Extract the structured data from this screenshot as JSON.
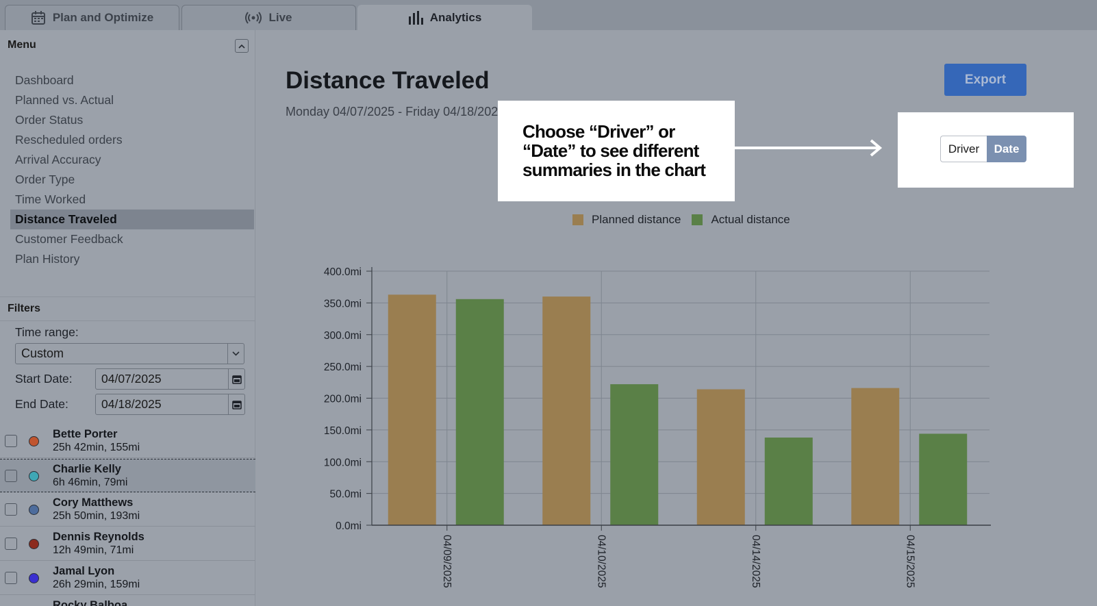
{
  "tabs": [
    {
      "label": "Plan and Optimize",
      "icon": "calendar-icon"
    },
    {
      "label": "Live",
      "icon": "broadcast-icon"
    },
    {
      "label": "Analytics",
      "icon": "bar-chart-icon"
    }
  ],
  "menu": {
    "title": "Menu",
    "items": [
      "Dashboard",
      "Planned vs. Actual",
      "Order Status",
      "Rescheduled orders",
      "Arrival Accuracy",
      "Order Type",
      "Time Worked",
      "Distance Traveled",
      "Customer Feedback",
      "Plan History"
    ],
    "active_index": 7
  },
  "filters": {
    "title": "Filters",
    "time_range_label": "Time range:",
    "time_range_value": "Custom",
    "start_label": "Start Date:",
    "start_value": "04/07/2025",
    "end_label": "End Date:",
    "end_value": "04/18/2025"
  },
  "drivers": [
    {
      "name": "Bette Porter",
      "stats": "25h 42min, 155mi",
      "color": "#c0552f"
    },
    {
      "name": "Charlie Kelly",
      "stats": "6h 46min, 79mi",
      "color": "#3fa7b5"
    },
    {
      "name": "Cory Matthews",
      "stats": "25h 50min, 193mi",
      "color": "#4d6c9c"
    },
    {
      "name": "Dennis Reynolds",
      "stats": "12h 49min, 71mi",
      "color": "#8c2b1e"
    },
    {
      "name": "Jamal Lyon",
      "stats": "26h 29min, 159mi",
      "color": "#3a2fd0"
    },
    {
      "name": "Rocky Balboa",
      "stats": "",
      "color": "#4aa03a"
    }
  ],
  "main": {
    "title": "Distance Traveled",
    "subtitle": "Monday 04/07/2025 - Friday 04/18/202",
    "export_label": "Export",
    "callout_lines": [
      "Choose “Driver” or",
      "“Date” to see different",
      "summaries in the chart"
    ],
    "toggle": {
      "driver": "Driver",
      "date": "Date",
      "selected": "Date"
    }
  },
  "chart_data": {
    "type": "bar",
    "categories": [
      "04/09/2025",
      "04/10/2025",
      "04/14/2025",
      "04/15/2025"
    ],
    "series": [
      {
        "name": "Planned distance",
        "color": "#9a7e50",
        "values": [
          363,
          360,
          214,
          216
        ]
      },
      {
        "name": "Actual distance",
        "color": "#5a8047",
        "values": [
          356,
          222,
          138,
          144
        ]
      }
    ],
    "yticks": [
      "0.0mi",
      "50.0mi",
      "100.0mi",
      "150.0mi",
      "200.0mi",
      "250.0mi",
      "300.0mi",
      "350.0mi",
      "400.0mi"
    ],
    "ylim": [
      0,
      400
    ],
    "grid": true,
    "legend": "top-center"
  }
}
